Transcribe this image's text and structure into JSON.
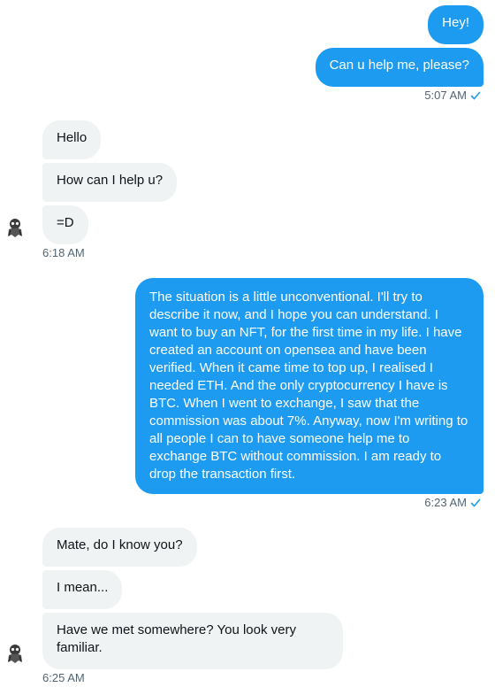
{
  "group1": {
    "messages": [
      "Hey!",
      "Can u help me, please?"
    ],
    "time": "5:07 AM"
  },
  "group2": {
    "messages": [
      "Hello",
      "How can I help u?",
      "=D"
    ],
    "time": "6:18 AM"
  },
  "group3": {
    "messages": [
      "The situation is a little unconventional. I'll try to describe it now, and I hope you can understand. I want to buy an NFT, for the first time in my life. I have created an account on opensea and have been verified. When it came time to top up, I realised I needed ETH. And the only cryptocurrency I have is BTC. When I went to exchange, I saw that the commission was about 7%. Anyway, now I'm writing to all people I can to have someone help me to exchange BTC without commission. I am ready to drop the transaction first."
    ],
    "time": "6:23 AM"
  },
  "group4": {
    "messages": [
      "Mate, do I know you?",
      "I mean...",
      "Have we met somewhere? You look very familiar."
    ],
    "time": "6:25 AM"
  },
  "icons": {
    "sent_indicator": "check-icon",
    "avatar": "avatar-icon"
  },
  "colors": {
    "outgoing": "#1d9bf0",
    "incoming": "#eff3f4",
    "meta": "#536471"
  }
}
